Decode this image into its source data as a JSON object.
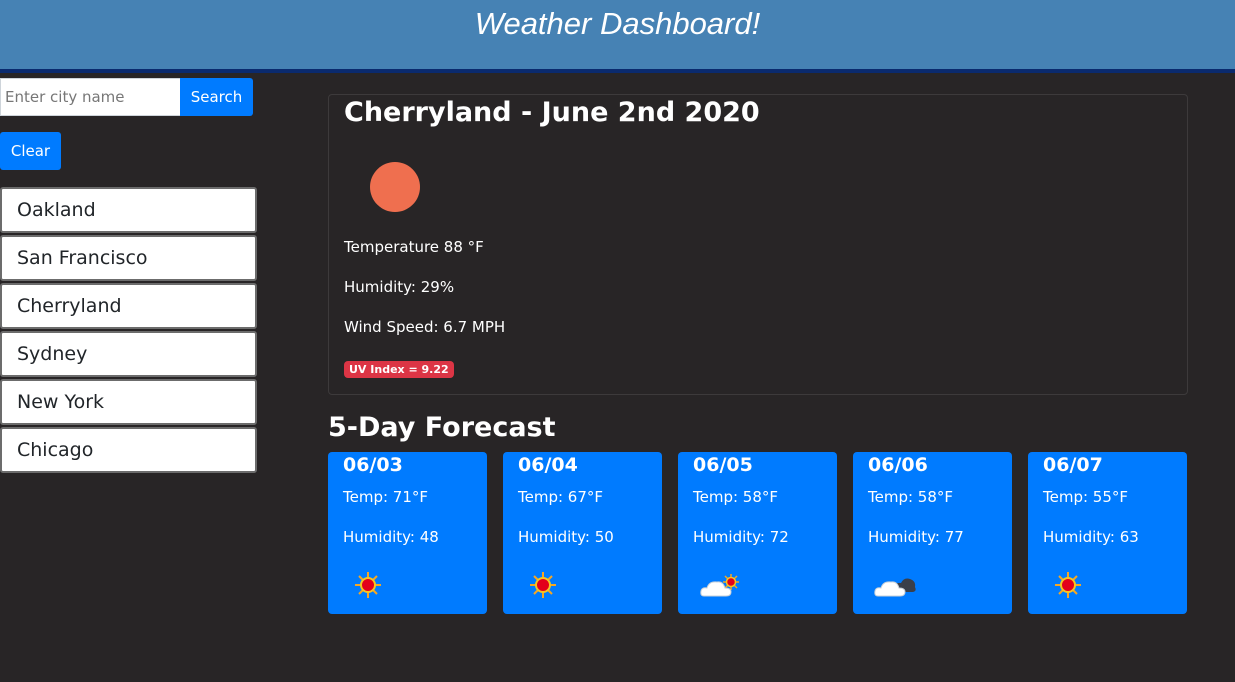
{
  "header": {
    "title": "Weather Dashboard!"
  },
  "search": {
    "placeholder": "Enter city name",
    "value": "",
    "button_label": "Search"
  },
  "clear_label": "Clear",
  "cities": [
    "Oakland",
    "San Francisco",
    "Cherryland",
    "Sydney",
    "New York",
    "Chicago"
  ],
  "current": {
    "title": "Cherryland - June 2nd 2020",
    "icon": "sun-icon",
    "icon_color": "#ef6f4f",
    "temperature": "Temperature 88 °F",
    "humidity": "Humidity: 29%",
    "wind": "Wind Speed: 6.7 MPH",
    "uv": "UV Index = 9.22",
    "uv_color": "#dc3545"
  },
  "forecast_heading": "5-Day Forecast",
  "forecast": [
    {
      "date": "06/03",
      "temp": "Temp: 71°F",
      "humidity": "Humidity: 48",
      "icon": "sun-icon"
    },
    {
      "date": "06/04",
      "temp": "Temp: 67°F",
      "humidity": "Humidity: 50",
      "icon": "sun-icon"
    },
    {
      "date": "06/05",
      "temp": "Temp: 58°F",
      "humidity": "Humidity: 72",
      "icon": "partly-cloudy-sun-icon"
    },
    {
      "date": "06/06",
      "temp": "Temp: 58°F",
      "humidity": "Humidity: 77",
      "icon": "partly-cloudy-night-icon"
    },
    {
      "date": "06/07",
      "temp": "Temp: 55°F",
      "humidity": "Humidity: 63",
      "icon": "sun-icon"
    }
  ],
  "colors": {
    "header": "#4682b4",
    "accent": "#007bff",
    "background": "#282526"
  }
}
